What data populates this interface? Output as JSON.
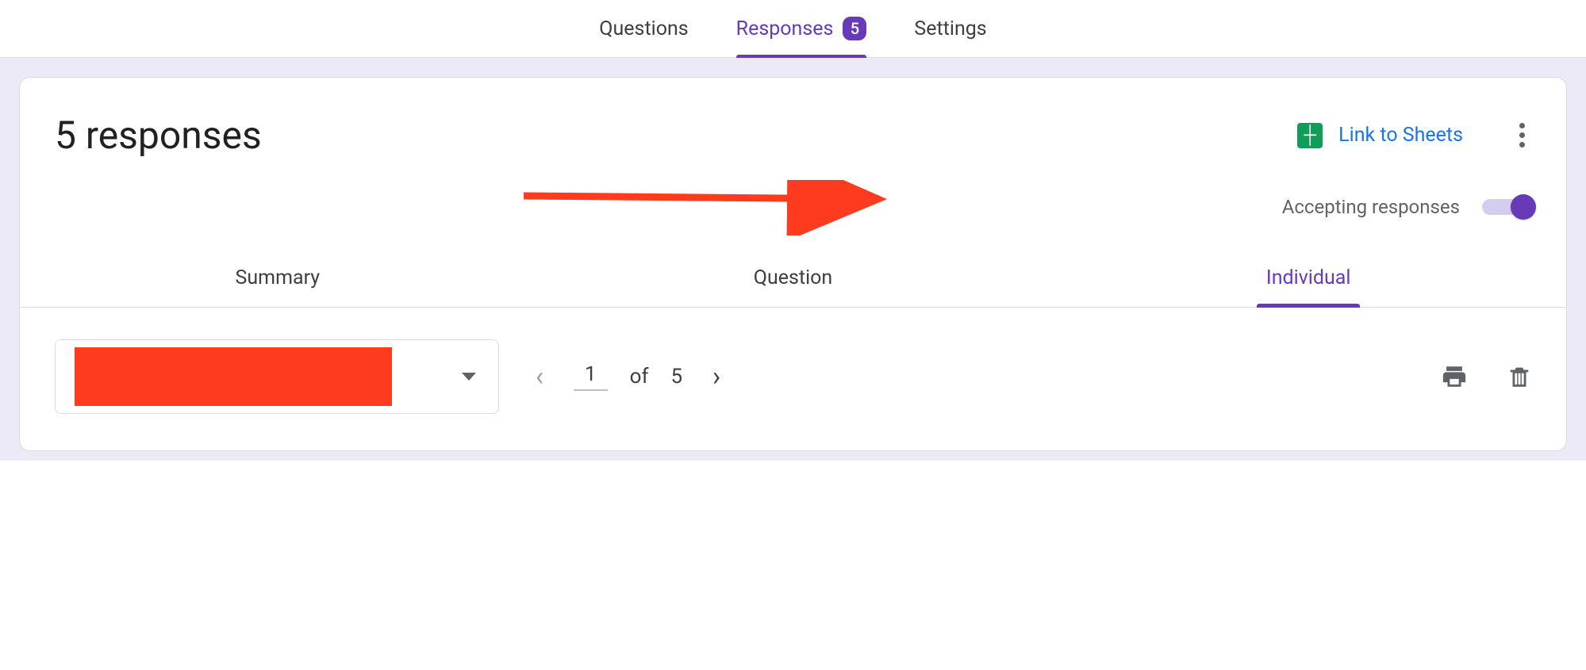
{
  "topnav": {
    "questions": "Questions",
    "responses": "Responses",
    "responses_badge": "5",
    "settings": "Settings"
  },
  "header": {
    "title": "5 responses",
    "link_to_sheets": "Link to Sheets"
  },
  "accepting": {
    "label": "Accepting responses",
    "on": true
  },
  "subtabs": {
    "summary": "Summary",
    "question": "Question",
    "individual": "Individual"
  },
  "pager": {
    "current": "1",
    "of_label": "of",
    "total": "5"
  }
}
